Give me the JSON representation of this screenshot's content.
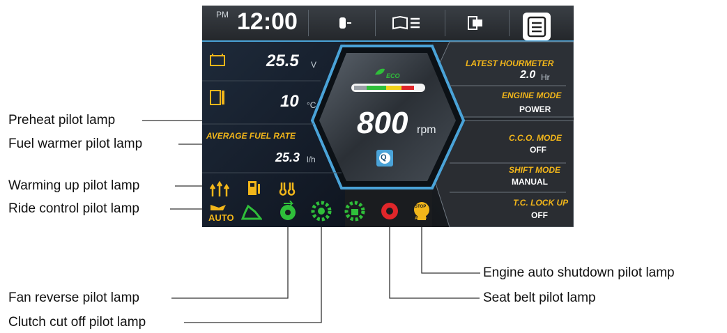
{
  "callouts": {
    "preheat": "Preheat pilot lamp",
    "fuel_warmer": "Fuel warmer pilot lamp",
    "warming_up": "Warming up pilot lamp",
    "ride_control": "Ride control pilot lamp",
    "fan_reverse": "Fan reverse pilot lamp",
    "clutch_cut_off": "Clutch cut off pilot lamp",
    "engine_auto_shutdown": "Engine auto shutdown pilot lamp",
    "seat_belt": "Seat belt pilot lamp"
  },
  "screen": {
    "clock": {
      "ampm": "PM",
      "time": "12:00"
    },
    "battery": {
      "value": "25.5",
      "unit": "V"
    },
    "coolant": {
      "value": "10",
      "unit": "°C"
    },
    "fuel_rate": {
      "label": "AVERAGE FUEL RATE",
      "value": "25.3",
      "unit": "l/h"
    },
    "eco_label": "ECO",
    "rpm": {
      "value": "800",
      "unit": "rpm"
    },
    "quick_badge": "Q",
    "right_panel": {
      "latest_hourmeter": {
        "label": "LATEST HOURMETER",
        "value": "2.0",
        "unit": "Hr"
      },
      "engine_mode": {
        "label": "ENGINE MODE",
        "value": "POWER"
      },
      "cco_mode": {
        "label": "C.C.O. MODE",
        "value": "OFF"
      },
      "shift_mode": {
        "label": "SHIFT MODE",
        "value": "MANUAL"
      },
      "tc_lock_up": {
        "label": "T.C. LOCK UP",
        "value": "OFF"
      }
    },
    "ride_control_badge": "AUTO",
    "shutdown_badge_top": "STOP",
    "shutdown_badge_bottom": "AUTO"
  },
  "colors": {
    "amber": "#f2b61a",
    "green": "#2fbf3a",
    "red": "#e0262a",
    "blue_accent": "#4aa3d8"
  }
}
